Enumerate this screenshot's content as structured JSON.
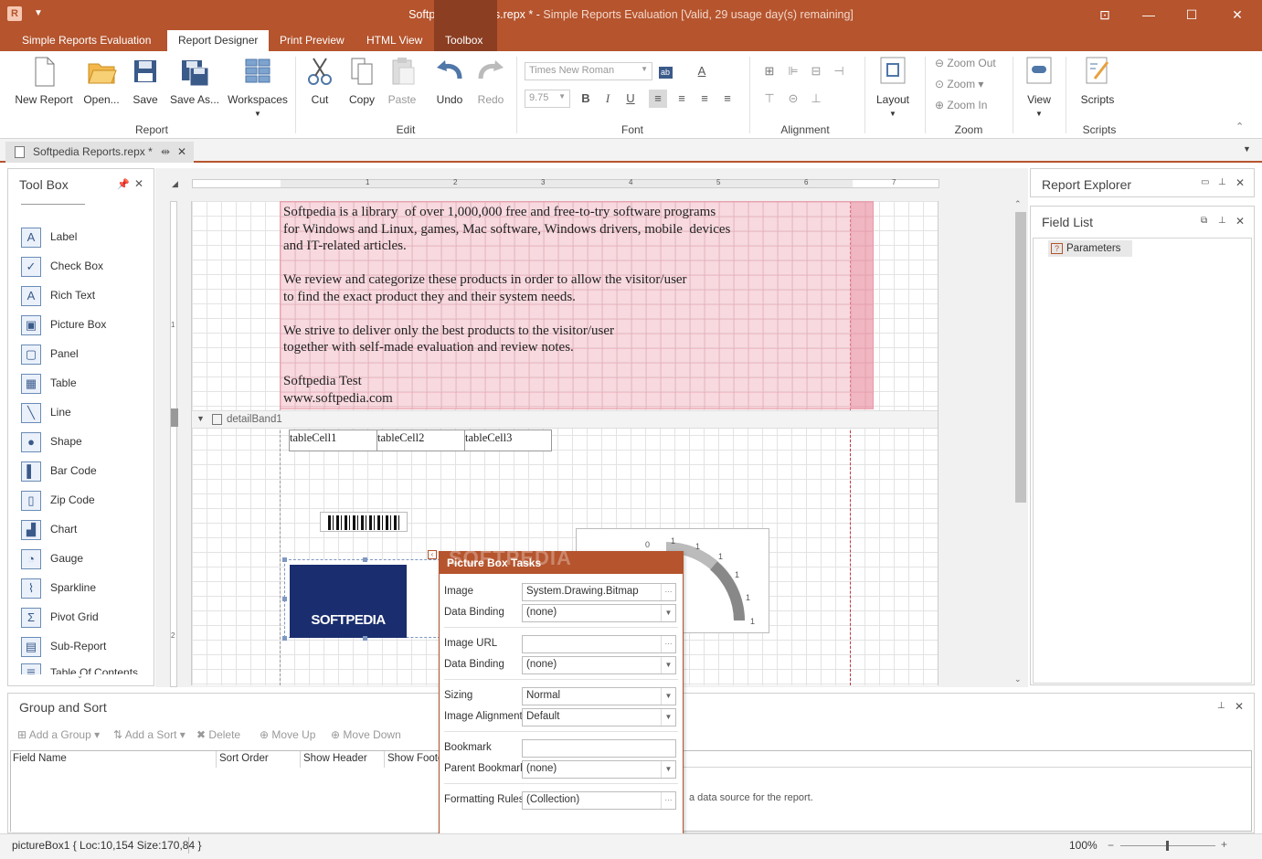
{
  "window": {
    "title_main": "Softpedia Reports.repx * - ",
    "title_sub": "Simple Reports Evaluation [Valid,  29 usage day(s) remaining]",
    "app_icon_letter": "R"
  },
  "tabs": [
    "Simple Reports Evaluation",
    "Report Designer",
    "Print Preview",
    "HTML View",
    "Toolbox"
  ],
  "ribbon": {
    "report": {
      "new": "New Report",
      "open": "Open...",
      "save": "Save",
      "save_as": "Save As...",
      "workspaces": "Workspaces",
      "group": "Report"
    },
    "edit": {
      "cut": "Cut",
      "copy": "Copy",
      "paste": "Paste",
      "undo": "Undo",
      "redo": "Redo",
      "group": "Edit"
    },
    "font": {
      "name": "Times New Roman",
      "size": "9.75",
      "bold": "B",
      "italic": "I",
      "underline": "U",
      "group": "Font"
    },
    "alignment": {
      "group": "Alignment",
      "layout": "Layout"
    },
    "zoom": {
      "out": "Zoom Out",
      "zoom": "Zoom",
      "in": "Zoom In",
      "group": "Zoom"
    },
    "view": {
      "label": "View",
      "scripts": "Scripts",
      "scripts_group": "Scripts"
    }
  },
  "doc_tab": "Softpedia Reports.repx *",
  "toolbox": {
    "title": "Tool Box",
    "items": [
      "Label",
      "Check Box",
      "Rich Text",
      "Picture Box",
      "Panel",
      "Table",
      "Line",
      "Shape",
      "Bar Code",
      "Zip Code",
      "Chart",
      "Gauge",
      "Sparkline",
      "Pivot Grid",
      "Sub-Report",
      "Table Of Contents"
    ]
  },
  "ruler": [
    "1",
    "2",
    "3",
    "4",
    "5",
    "6",
    "7"
  ],
  "vruler": [
    "1",
    "2"
  ],
  "canvas": {
    "text": "Softpedia is a library  of over 1,000,000 free and free-to-try software programs\nfor Windows and Linux, games, Mac software, Windows drivers, mobile  devices\nand IT-related articles.\n\nWe review and categorize these products in order to allow the visitor/user\nto find the exact product they and their system needs.\n\nWe strive to deliver only the best products to the visitor/user\ntogether with self-made evaluation and review notes.\n\nSoftpedia Test\nwww.softpedia.com",
    "band": "detailBand1",
    "cells": [
      "tableCell1",
      "tableCell2",
      "tableCell3"
    ],
    "picture_text": "SOFTPEDIA",
    "watermark": "SOFTPEDIA",
    "gauge_labels": [
      "0",
      "1",
      "1",
      "1",
      "1",
      "1",
      "1"
    ]
  },
  "report_explorer": {
    "title": "Report Explorer"
  },
  "field_list": {
    "title": "Field List",
    "item": "Parameters"
  },
  "tasks": {
    "title": "Picture Box Tasks",
    "rows": [
      {
        "label": "Image",
        "value": "System.Drawing.Bitmap",
        "kind": "ellipsis"
      },
      {
        "label": "Data Binding",
        "value": "(none)",
        "kind": "dropdown"
      },
      {
        "label": "Image URL",
        "value": "",
        "kind": "ellipsis"
      },
      {
        "label": "Data Binding",
        "value": "(none)",
        "kind": "dropdown"
      },
      {
        "label": "Sizing",
        "value": "Normal",
        "kind": "dropdown"
      },
      {
        "label": "Image Alignment",
        "value": "Default",
        "kind": "dropdown"
      },
      {
        "label": "Bookmark",
        "value": "",
        "kind": "text"
      },
      {
        "label": "Parent Bookmark",
        "value": "(none)",
        "kind": "dropdown"
      },
      {
        "label": "Formatting Rules",
        "value": "(Collection)",
        "kind": "ellipsis"
      }
    ]
  },
  "group_sort": {
    "title": "Group and Sort",
    "buttons": [
      "Add a Group",
      "Add a Sort",
      "Delete",
      "Move Up",
      "Move Down"
    ],
    "columns": [
      "Field Name",
      "Sort Order",
      "Show Header",
      "Show Footer"
    ],
    "message": "a data source for the report."
  },
  "status": {
    "left": "pictureBox1 { Loc:10,154 Size:170,84 }",
    "zoom": "100%"
  },
  "colors": {
    "accent": "#b5542d",
    "pink": "#f0b4c0",
    "navy": "#1a2d6e"
  }
}
